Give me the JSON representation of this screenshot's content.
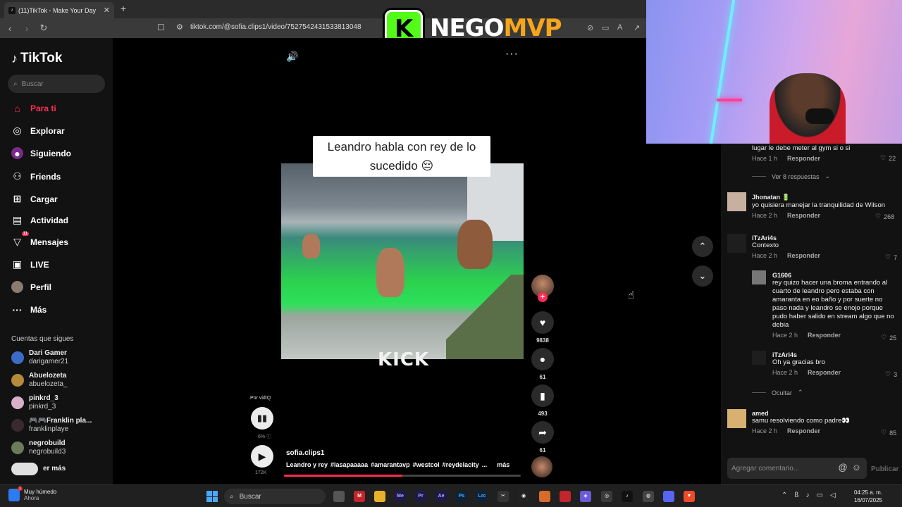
{
  "browser": {
    "tab_title": "(11)TikTok - Make Your Day",
    "tab_favicon": "tiktok-icon",
    "new_tab": "+",
    "close_tab": "✕",
    "url": "tiktok.com/@sofia.clips1/video/7527542431533813048"
  },
  "overlay": {
    "logo_letter": "K",
    "brand_a": "NEGO",
    "brand_b": "MVP"
  },
  "sidebar": {
    "logo": "TikTok",
    "search_placeholder": "Buscar",
    "nav": [
      {
        "label": "Para ti",
        "icon": "home-icon",
        "active": true
      },
      {
        "label": "Explorar",
        "icon": "compass-icon"
      },
      {
        "label": "Siguiendo",
        "icon": "following-icon"
      },
      {
        "label": "Friends",
        "icon": "friends-icon"
      },
      {
        "label": "Cargar",
        "icon": "upload-icon"
      },
      {
        "label": "Actividad",
        "icon": "activity-icon"
      },
      {
        "label": "Mensajes",
        "icon": "messages-icon",
        "badge": "11"
      },
      {
        "label": "LIVE",
        "icon": "live-icon"
      },
      {
        "label": "Perfil",
        "icon": "profile-avatar"
      },
      {
        "label": "Más",
        "icon": "more-icon"
      }
    ],
    "following_title": "Cuentas que sigues",
    "accounts": [
      {
        "name": "Dari Gamer",
        "handle": "darigamer21"
      },
      {
        "name": "Abuelozeta",
        "handle": "abuelozeta_"
      },
      {
        "name": "pinkrd_3",
        "handle": "pinkrd_3"
      },
      {
        "name": "🎮🎮Franklin pla...",
        "handle": "franklinplaye"
      },
      {
        "name": "negrobuild",
        "handle": "negrobuild3"
      },
      {
        "name": "",
        "handle": "er más"
      }
    ]
  },
  "video": {
    "caption": "Leandro habla con rey de lo sucedido 😔",
    "watermark": "KICK",
    "likes": "9838",
    "comments": "61",
    "saves": "493",
    "shares": "61",
    "vidiq_label": "Por vidIQ",
    "vidiq_pct": "6%",
    "views": "172K",
    "creator": "sofia.clips1",
    "description": [
      "Leandro y rey",
      "#lasapaaaaa",
      "#amarantavp",
      "#westcol",
      "#reydelacity",
      "..."
    ],
    "more": "más",
    "progress": 0.5
  },
  "comments": [
    {
      "user": "",
      "text": "lugar le debe meter al gym si o si",
      "time": "Hace 1 h",
      "reply": "Responder",
      "likes": "22"
    },
    {
      "user": "Jhonatan 🔋",
      "text": "yo quisiera manejar la tranquilidad de Wilson",
      "time": "Hace 2 h",
      "reply": "Responder",
      "likes": "268"
    },
    {
      "user": "iTzAri4s",
      "text": "Contexto",
      "time": "Hace 2 h",
      "reply": "Responder",
      "likes": "7"
    },
    {
      "user": "G1606",
      "text": "rey quizo hacer una broma entrando al cuarto de leandro pero estaba con amaranta en eo baño y por suerte no paso nada y leandro se enojo porque pudo haber salido en stream algo que no debia",
      "time": "Hace 2 h",
      "reply": "Responder",
      "likes": "25"
    },
    {
      "user": "iTzAri4s",
      "text": "Oh ya gracias bro",
      "time": "Hace 2 h",
      "reply": "Responder",
      "likes": "3"
    },
    {
      "user": "amed",
      "text": "samu resolviendo como padre👀",
      "time": "Hace 2 h",
      "reply": "Responder",
      "likes": "85"
    }
  ],
  "replies_toggle": {
    "more": "Ver 8 respuestas",
    "hide": "Ocultar"
  },
  "comment_box": {
    "placeholder": "Agregar comentario...",
    "publish": "Publicar"
  },
  "taskbar": {
    "weather_main": "Muy húmedo",
    "weather_sub": "Ahora",
    "weather_badge": "1",
    "search": "Buscar",
    "time": "04:25 a. m.",
    "date": "16/07/2025"
  },
  "colors": {
    "accent": "#fe2c55",
    "kick_green": "#53fc18",
    "brand_orange": "#f7a51a"
  }
}
